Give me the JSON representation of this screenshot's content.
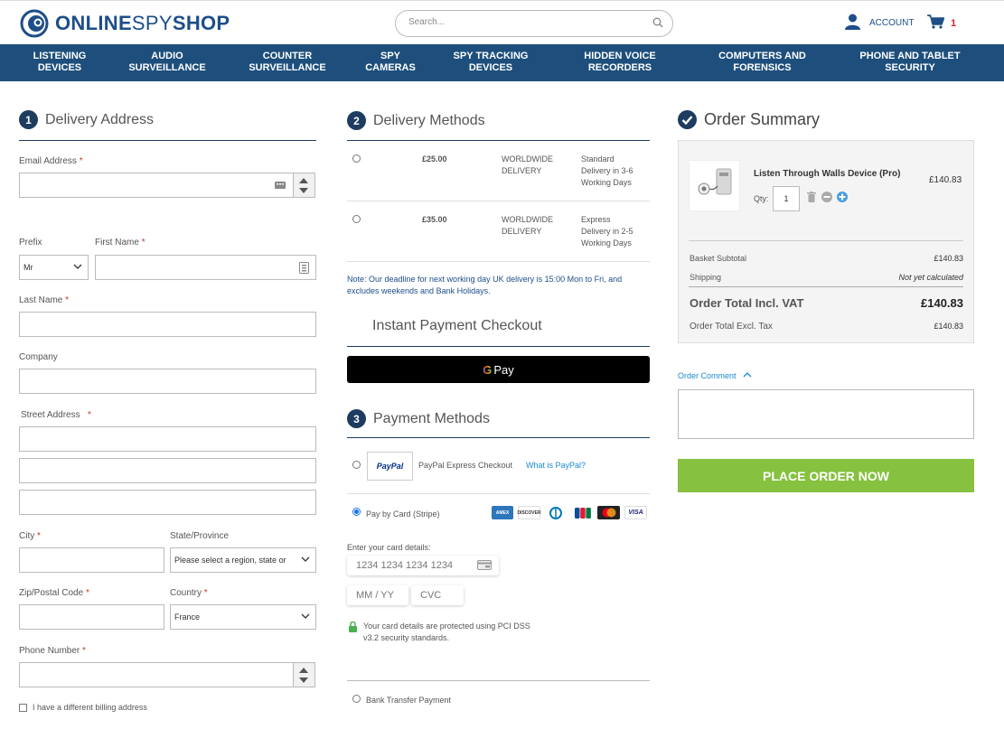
{
  "header": {
    "logo": {
      "online": "ONLINE",
      "spy": "SPY",
      "shop": "SHOP"
    },
    "search_placeholder": "Search...",
    "account_label": "ACCOUNT",
    "cart_count": "1"
  },
  "nav": [
    "LISTENING\nDEVICES",
    "AUDIO\nSURVEILLANCE",
    "COUNTER\nSURVEILLANCE",
    "SPY\nCAMERAS",
    "SPY TRACKING\nDEVICES",
    "HIDDEN VOICE\nRECORDERS",
    "COMPUTERS AND\nFORENSICS",
    "PHONE AND TABLET\nSECURITY"
  ],
  "delivery_address": {
    "step": "1",
    "title": "Delivery Address",
    "email_label": "Email Address",
    "prefix_label": "Prefix",
    "prefix_value": "Mr",
    "first_name_label": "First Name",
    "last_name_label": "Last Name",
    "company_label": "Company",
    "street_label": "Street Address",
    "city_label": "City",
    "state_label": "State/Province",
    "state_value": "Please select a region, state or",
    "zip_label": "Zip/Postal Code",
    "country_label": "Country",
    "country_value": "France",
    "phone_label": "Phone Number",
    "billing_label": "I have a different billing address",
    "required_mark": "*"
  },
  "delivery_methods": {
    "step": "2",
    "title": "Delivery Methods",
    "options": [
      {
        "price": "£25.00",
        "carrier": "WORLDWIDE\nDELIVERY",
        "desc": "Standard\nDelivery in 3-6\nWorking Days"
      },
      {
        "price": "£35.00",
        "carrier": "WORLDWIDE\nDELIVERY",
        "desc": "Express\nDelivery in 2-5\nWorking Days"
      }
    ],
    "note": "Note: Our deadline for next working day UK delivery is 15:00 Mon to Fri, and excludes weekends and Bank Holidays."
  },
  "instant_payment": {
    "title": "Instant Payment Checkout",
    "gpay_g": "G",
    "gpay_label": "Pay"
  },
  "payment_methods": {
    "step": "3",
    "title": "Payment Methods",
    "paypal_logo": "PayPal",
    "paypal_label": "PayPal Express Checkout",
    "paypal_link": "What is PayPal?",
    "card_label": "Pay by Card (Stripe)",
    "card_logos": [
      "AMEX",
      "DISCOVER",
      "DINERS",
      "JCB",
      "MASTERCARD",
      "VISA"
    ],
    "card_details_label": "Enter your card details:",
    "card_number_placeholder": "1234 1234 1234 1234",
    "expiry_placeholder": "MM / YY",
    "cvc_placeholder": "CVC",
    "security_note": "Your card details are protected using PCI DSS v3.2 security standards.",
    "bank_transfer_label": "Bank Transfer Payment"
  },
  "order_summary": {
    "title": "Order Summary",
    "product_name": "Listen Through Walls Device (Pro)",
    "product_price": "£140.83",
    "qty_label": "Qty:",
    "qty_value": "1",
    "subtotal_label": "Basket Subtotal",
    "subtotal_value": "£140.83",
    "shipping_label": "Shipping",
    "shipping_value": "Not yet calculated",
    "total_incl_label": "Order Total Incl. VAT",
    "total_incl_value": "£140.83",
    "total_excl_label": "Order Total Excl. Tax",
    "total_excl_value": "£140.83",
    "comment_label": "Order Comment",
    "place_order_label": "PLACE ORDER NOW"
  },
  "colors": {
    "brand": "#1d4e89",
    "nav": "#1e4f7c",
    "cta": "#86c13f",
    "required": "#c0392b",
    "link": "#1a8ad1"
  }
}
